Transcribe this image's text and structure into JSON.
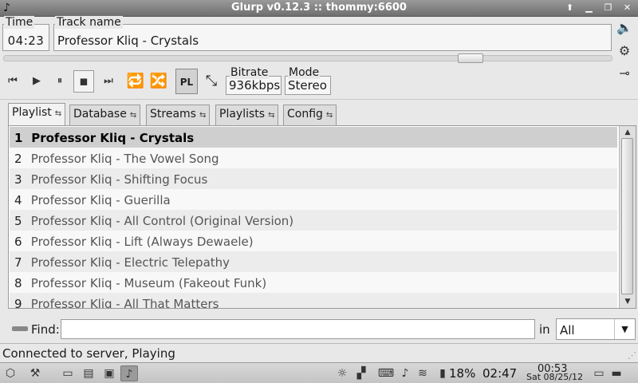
{
  "window": {
    "title": "Glurp v0.12.3 :: thommy:6600",
    "icon": "music-note-icon",
    "buttons": [
      "up-icon",
      "minimize-icon",
      "restore-icon",
      "close-icon"
    ]
  },
  "player": {
    "time_label": "Time",
    "time_value": "04:23",
    "track_label": "Track name",
    "track_value": "Professor Kliq - Crystals",
    "seek_fraction": 0.78,
    "bitrate_label": "Bitrate",
    "bitrate_value": "936kbps",
    "mode_label": "Mode",
    "mode_value": "Stereo",
    "playlist_toggle": "PL"
  },
  "tabs": [
    {
      "label": "Playlist",
      "suffix": "⇆"
    },
    {
      "label": "Database",
      "suffix": "⇆"
    },
    {
      "label": "Streams",
      "suffix": "⇆"
    },
    {
      "label": "Playlists",
      "suffix": "⇆"
    },
    {
      "label": "Config",
      "suffix": "⇆"
    }
  ],
  "playlist": {
    "current_index": 0,
    "rows": [
      {
        "num": "1",
        "title": "Professor Kliq - Crystals"
      },
      {
        "num": "2",
        "title": "Professor Kliq - The Vowel Song"
      },
      {
        "num": "3",
        "title": "Professor Kliq - Shifting Focus"
      },
      {
        "num": "4",
        "title": "Professor Kliq - Guerilla"
      },
      {
        "num": "5",
        "title": "Professor Kliq - All Control (Original Version)"
      },
      {
        "num": "6",
        "title": "Professor Kliq - Lift (Always Dewaele)"
      },
      {
        "num": "7",
        "title": "Professor Kliq - Electric Telepathy"
      },
      {
        "num": "8",
        "title": "Professor Kliq - Museum (Fakeout Funk)"
      },
      {
        "num": "9",
        "title": "Professor Kliq - All That Matters"
      }
    ]
  },
  "find": {
    "label": "Find:",
    "value": "",
    "in_label": "in",
    "scope_selected": "All"
  },
  "status": {
    "text": "Connected to server, Playing"
  },
  "taskbar": {
    "battery": "18%",
    "battery_time": "02:47",
    "clock_time": "00:53",
    "clock_date": "Sat 08/25/12"
  }
}
